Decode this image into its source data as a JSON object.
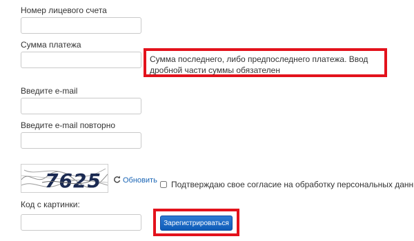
{
  "form": {
    "account_label": "Номер лицевого счета",
    "account_value": "",
    "amount_label": "Сумма платежа",
    "amount_value": "",
    "amount_hint": "Сумма последнего, либо предпоследнего платежа. Ввод дробной части суммы обязателен",
    "email_label": "Введите e-mail",
    "email_value": "",
    "email_repeat_label": "Введите e-mail повторно",
    "email_repeat_value": "",
    "captcha_text": "7625",
    "refresh_icon": "refresh-icon",
    "refresh_label": "Обновить",
    "consent_label": "Подтверждаю свое согласие на обработку персональных данных",
    "consent_checked": false,
    "captcha_code_label": "Код с картинки:",
    "captcha_code_value": "",
    "submit_label": "Зарегистрироваться"
  },
  "colors": {
    "highlight": "#e3121c",
    "button": "#1a65c4",
    "link": "#1a65b5"
  }
}
